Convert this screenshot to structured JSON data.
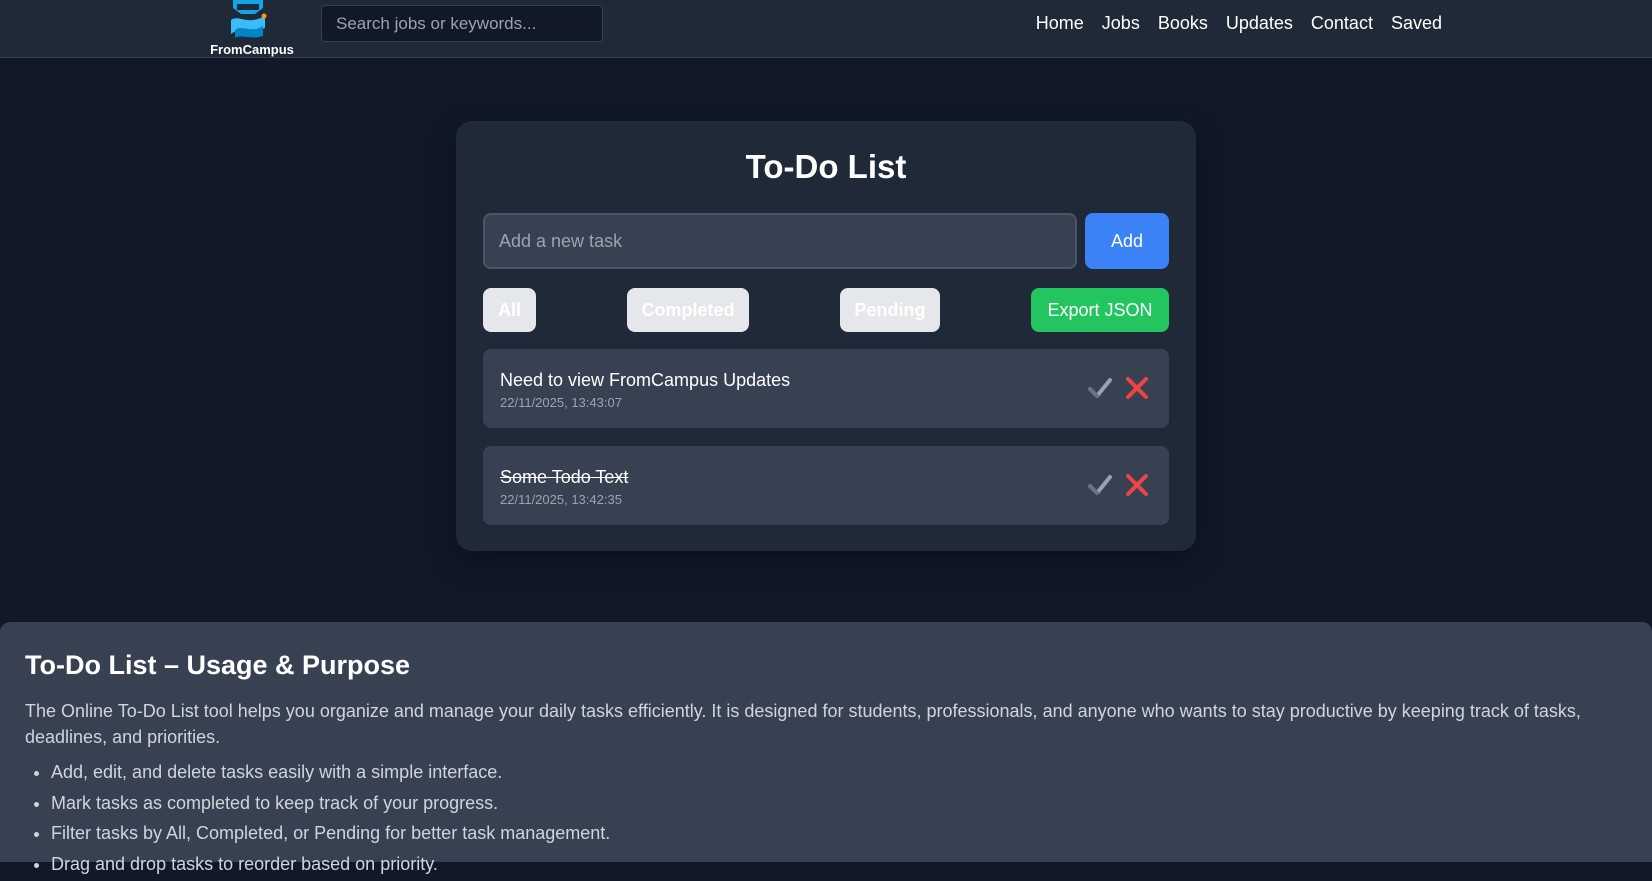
{
  "header": {
    "logo_text": "FromCampus",
    "search": {
      "placeholder": "Search jobs or keywords...",
      "value": ""
    },
    "nav": [
      "Home",
      "Jobs",
      "Books",
      "Updates",
      "Contact",
      "Saved"
    ]
  },
  "todo": {
    "title": "To-Do List",
    "input": {
      "placeholder": "Add a new task",
      "value": ""
    },
    "add_label": "Add",
    "filters": {
      "all": "All",
      "completed": "Completed",
      "pending": "Pending"
    },
    "export_label": "Export JSON",
    "tasks": [
      {
        "text": "Need to view FromCampus Updates",
        "date": "22/11/2025, 13:43:07",
        "completed": false
      },
      {
        "text": "Some Todo Text",
        "date": "22/11/2025, 13:42:35",
        "completed": true
      }
    ]
  },
  "info": {
    "title": "To-Do List – Usage & Purpose",
    "description": "The Online To-Do List tool helps you organize and manage your daily tasks efficiently. It is designed for students, professionals, and anyone who wants to stay productive by keeping track of tasks, deadlines, and priorities.",
    "features": [
      "Add, edit, and delete tasks easily with a simple interface.",
      "Mark tasks as completed to keep track of your progress.",
      "Filter tasks by All, Completed, or Pending for better task management.",
      "Drag and drop tasks to reorder based on priority."
    ]
  },
  "colors": {
    "background": "#111827",
    "surface": "#1f2937",
    "item": "#374151",
    "primary": "#3b82f6",
    "export": "#22c55e",
    "delete": "#ef4444",
    "check": "#94a3b8"
  },
  "icons": {
    "check": "check-icon",
    "delete": "close-icon",
    "logo": "graduation-cap-icon"
  }
}
